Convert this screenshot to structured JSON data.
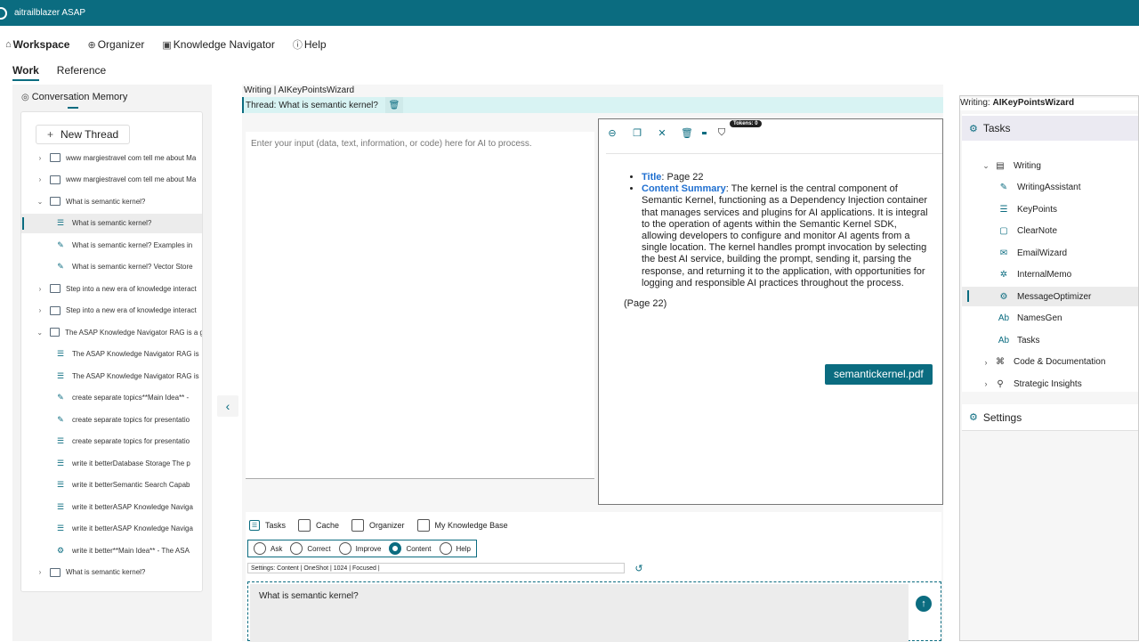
{
  "app": {
    "title": "aitrailblazer ASAP"
  },
  "nav": {
    "items": [
      {
        "label": "Workspace",
        "icon": "home-icon"
      },
      {
        "label": "Organizer",
        "icon": "globe-icon"
      },
      {
        "label": "Knowledge Navigator",
        "icon": "navigator-icon"
      },
      {
        "label": "Help",
        "icon": "help-icon"
      }
    ]
  },
  "subtabs": {
    "work": "Work",
    "reference": "Reference"
  },
  "memory": {
    "header": "Conversation Memory",
    "new_thread": "New Thread",
    "rows": [
      {
        "text": "www margiestravel com tell me about Ma",
        "kind": "folder",
        "chev": "›"
      },
      {
        "text": "www margiestravel com tell me about Ma",
        "kind": "folder",
        "chev": "›"
      },
      {
        "text": "What is semantic kernel?",
        "kind": "folder-open",
        "chev": "⌄"
      },
      {
        "text": "What is semantic kernel?",
        "kind": "list"
      },
      {
        "text": "What is semantic kernel? Examples in",
        "kind": "pen"
      },
      {
        "text": "What is semantic kernel? Vector Store",
        "kind": "pen"
      },
      {
        "text": "Step into a new era of knowledge interact",
        "kind": "folder",
        "chev": "›"
      },
      {
        "text": "Step into a new era of knowledge interact",
        "kind": "folder",
        "chev": "›"
      },
      {
        "text": "The ASAP Knowledge Navigator RAG is a g",
        "kind": "folder-open",
        "chev": "⌄"
      },
      {
        "text": "The ASAP Knowledge Navigator RAG is",
        "kind": "list"
      },
      {
        "text": "The ASAP Knowledge Navigator RAG is",
        "kind": "list"
      },
      {
        "text": "create separate topics**Main Idea** -",
        "kind": "pen"
      },
      {
        "text": "create separate topics for presentatio",
        "kind": "pen"
      },
      {
        "text": "create separate topics for presentatio",
        "kind": "list"
      },
      {
        "text": "write it betterDatabase Storage The p",
        "kind": "list"
      },
      {
        "text": "write it betterSemantic Search Capab",
        "kind": "list"
      },
      {
        "text": "write it betterASAP Knowledge Naviga",
        "kind": "list"
      },
      {
        "text": "write it betterASAP Knowledge Naviga",
        "kind": "list"
      },
      {
        "text": "write it better**Main Idea** - The ASA",
        "kind": "gear"
      },
      {
        "text": "What is semantic kernel?",
        "kind": "folder",
        "chev": "›"
      }
    ]
  },
  "center": {
    "writing_title": "Writing | AIKeyPointsWizard",
    "thread": "Thread: What is semantic kernel?",
    "input_placeholder": "Enter your input (data, text, information, or code) here for AI to process.",
    "tokens": "Tokens: 0"
  },
  "output": {
    "title_label": "Title",
    "title_value": ": Page 22",
    "summary_label": "Content Summary",
    "summary_value": ": The kernel is the central component of Semantic Kernel, functioning as a Dependency Injection container that manages services and plugins for AI applications. It is integral to the operation of agents within the Semantic Kernel SDK, allowing developers to configure and monitor AI agents from a single location. The kernel handles prompt invocation by selecting the best AI service, building the prompt, sending it, parsing the response, and returning it to the application, with opportunities for logging and responsible AI practices throughout the process.",
    "page_note": "(Page 22)",
    "pdf_button": "semantickernel.pdf"
  },
  "controls": {
    "tasks": "Tasks",
    "cache": "Cache",
    "organizer": "Organizer",
    "kb": "My Knowledge Base",
    "radios": [
      "Ask",
      "Correct",
      "Improve",
      "Content",
      "Help"
    ],
    "radio_selected": "Content",
    "settings_line": "Settings:   Content |   OneShot |   1024 |   Focused |",
    "prompt": "What is semantic kernel?"
  },
  "right": {
    "title_prefix": "Writing: ",
    "title_value": "AIKeyPointsWizard",
    "tasks_header": "Tasks",
    "items": [
      {
        "label": "Writing",
        "icon": "document-icon",
        "indent": 1,
        "chev": "⌄"
      },
      {
        "label": "WritingAssistant",
        "icon": "pen-icon",
        "indent": 2
      },
      {
        "label": "KeyPoints",
        "icon": "list-icon",
        "indent": 2
      },
      {
        "label": "ClearNote",
        "icon": "note-icon",
        "indent": 2
      },
      {
        "label": "EmailWizard",
        "icon": "mail-icon",
        "indent": 2
      },
      {
        "label": "InternalMemo",
        "icon": "spark-icon",
        "indent": 2
      },
      {
        "label": "MessageOptimizer",
        "icon": "gear-icon",
        "indent": 2,
        "selected": true
      },
      {
        "label": "NamesGen",
        "icon": "ab-icon",
        "indent": 2
      },
      {
        "label": "Tasks",
        "icon": "ab-icon",
        "indent": 2
      },
      {
        "label": "Code & Documentation",
        "icon": "code-icon",
        "indent": 1,
        "chev": "›"
      },
      {
        "label": "Strategic Insights",
        "icon": "insight-icon",
        "indent": 1,
        "chev": "›"
      }
    ],
    "settings": "Settings"
  },
  "colors": {
    "accent": "#0b6c80",
    "threadbar": "#d8f3f3",
    "link": "#1f6fd0"
  }
}
